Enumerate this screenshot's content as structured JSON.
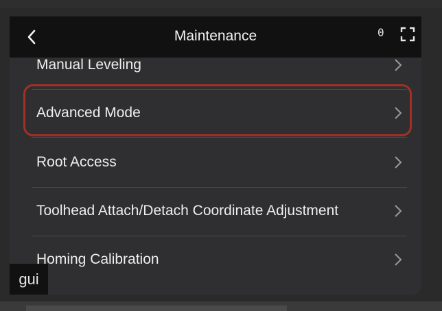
{
  "header": {
    "title": "Maintenance",
    "counter": "0"
  },
  "menu": {
    "items": [
      {
        "label": "Manual Leveling"
      },
      {
        "label": "Advanced Mode",
        "highlighted": true
      },
      {
        "label": "Root Access"
      },
      {
        "label": "Toolhead Attach/Detach Coordinate Adjustment"
      },
      {
        "label": "Homing Calibration"
      }
    ]
  },
  "overlay": {
    "tag": "gui"
  },
  "colors": {
    "highlight": "#a33024",
    "header_bg": "#111111",
    "panel_bg": "#2f2f31"
  },
  "icons": {
    "back": "chevron-left-icon",
    "fullscreen": "fullscreen-icon",
    "item_arrow": "chevron-right-icon"
  }
}
